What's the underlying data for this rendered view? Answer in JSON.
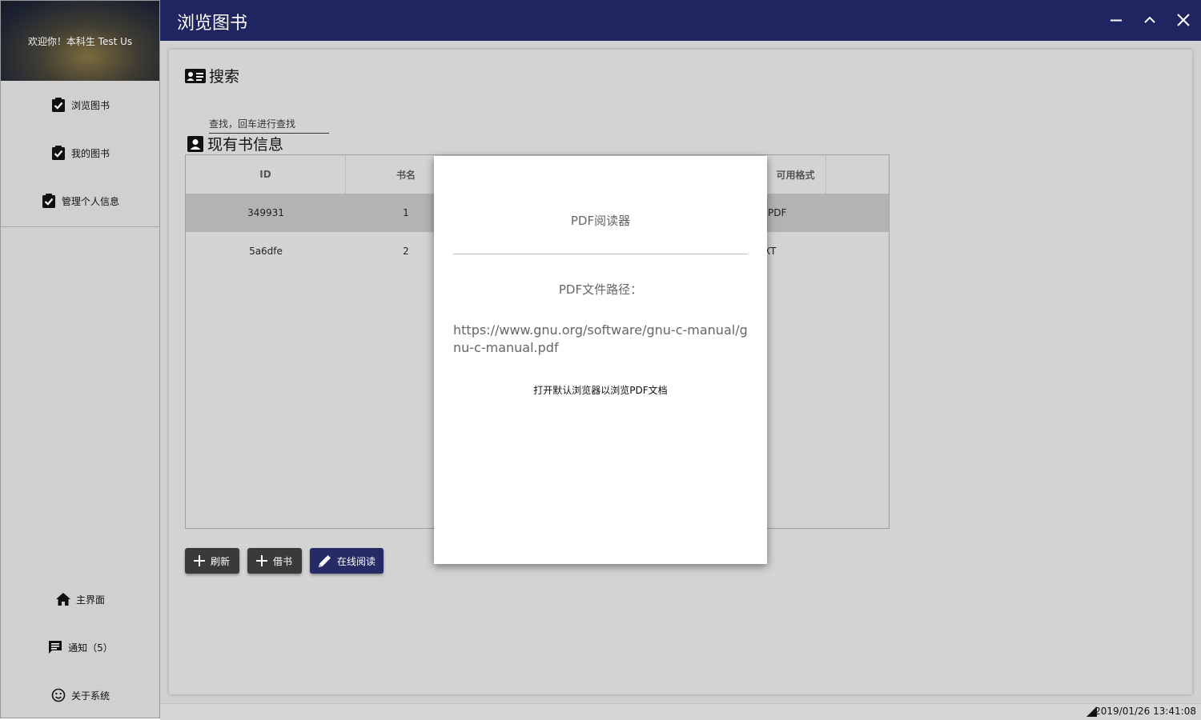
{
  "sidebar": {
    "welcome": "欢迎你！本科生 Test Us",
    "nav": [
      {
        "label": "浏览图书",
        "icon": "clipboard-check-icon"
      },
      {
        "label": "我的图书",
        "icon": "clipboard-check-icon"
      },
      {
        "label": "管理个人信息",
        "icon": "clipboard-check-icon"
      }
    ],
    "bottom": [
      {
        "label": "主界面",
        "icon": "home-icon"
      },
      {
        "label": "通知（5）",
        "icon": "message-icon"
      },
      {
        "label": "关于系统",
        "icon": "smiley-icon"
      }
    ]
  },
  "titlebar": {
    "title": "浏览图书",
    "controls": [
      "minimize",
      "maximize",
      "close"
    ]
  },
  "search": {
    "heading": "搜索",
    "placeholder": "查找，回车进行查找"
  },
  "books": {
    "heading": "现有书信息",
    "columns": [
      "ID",
      "书名",
      "可用格式"
    ],
    "rows": [
      {
        "id": "349931",
        "name": "1",
        "format": "PDF",
        "selected": true
      },
      {
        "id": "5a6dfe",
        "name": "2",
        "format": "XT",
        "selected": false
      }
    ]
  },
  "buttons": {
    "refresh": "刷新",
    "borrow": "借书",
    "read_online": "在线阅读"
  },
  "dialog": {
    "title": "PDF阅读器",
    "path_label": "PDF文件路径：",
    "path": "https://www.gnu.org/software/gnu-c-manual/gnu-c-manual.pdf",
    "open_link": "打开默认浏览器以浏览PDF文档"
  },
  "status": {
    "datetime": "2019/01/26 13:41:08"
  },
  "colors": {
    "titlebar": "#1f2561",
    "accent_button": "#262b66",
    "dark_button": "#3a3a3a"
  }
}
